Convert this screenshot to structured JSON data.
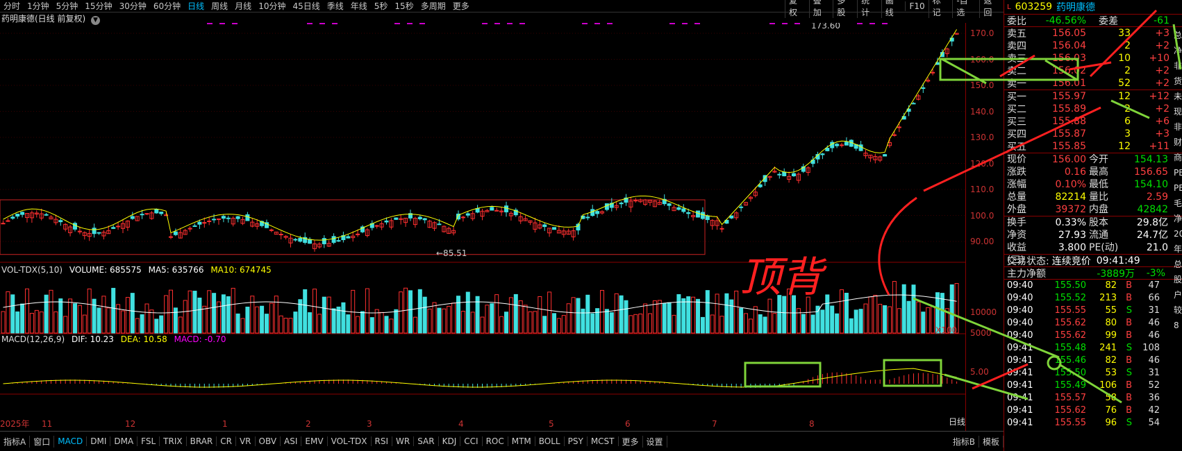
{
  "toolbar": {
    "periods": [
      "分时",
      "1分钟",
      "5分钟",
      "15分钟",
      "30分钟",
      "60分钟",
      "日线",
      "周线",
      "月线",
      "10分钟",
      "45日线",
      "季线",
      "年线",
      "5秒",
      "15秒",
      "多周期",
      "更多"
    ],
    "active_period": "日线",
    "right_buttons": [
      "复权",
      "叠加",
      "多股",
      "统计",
      "画线",
      "F10",
      "标记",
      "-自选",
      "返回"
    ]
  },
  "chart": {
    "title": "药明康德(日线 前复权)",
    "y_axis": [
      "170.0",
      "160.0",
      "150.0",
      "140.0",
      "130.0",
      "120.0",
      "110.0",
      "100.0",
      "90.00"
    ],
    "high_marker": "173.60",
    "low_marker": "85.51",
    "x_axis": [
      "2025年",
      "11",
      "12",
      "1",
      "2",
      "3",
      "4",
      "5",
      "6",
      "7",
      "8"
    ],
    "period_label": "日线",
    "vol_legend": {
      "name": "VOL-TDX(5,10)",
      "volume": "VOLUME: 685575",
      "ma5": "MA5: 635766",
      "ma10": "MA10: 674745"
    },
    "vol_axis": [
      "10000",
      "5000",
      "X100"
    ],
    "macd_legend": {
      "name": "MACD(12,26,9)",
      "dif": "DIF: 10.23",
      "dea": "DEA: 10.58",
      "macd": "MACD: -0.70"
    },
    "macd_axis": [
      "5.00"
    ],
    "annotation": "顶背"
  },
  "bottom_tabs": [
    "指标A",
    "窗口",
    "MACD",
    "DMI",
    "DMA",
    "FSL",
    "TRIX",
    "BRAR",
    "CR",
    "VR",
    "OBV",
    "ASI",
    "EMV",
    "VOL-TDX",
    "RSI",
    "WR",
    "SAR",
    "KDJ",
    "CCI",
    "ROC",
    "MTM",
    "BOLL",
    "PSY",
    "MCST",
    "更多",
    "设置"
  ],
  "bottom_right": [
    "指标B",
    "模板"
  ],
  "panel": {
    "code": "603259",
    "name": "药明康德",
    "weibi": {
      "label": "委比",
      "value": "-46.56%",
      "label2": "委差",
      "value2": "-61"
    },
    "asks": [
      {
        "label": "卖五",
        "price": "156.05",
        "vol": "33",
        "chg": "+3"
      },
      {
        "label": "卖四",
        "price": "156.04",
        "vol": "2",
        "chg": "+2"
      },
      {
        "label": "卖三",
        "price": "156.03",
        "vol": "10",
        "chg": "+10"
      },
      {
        "label": "卖二",
        "price": "156.02",
        "vol": "2",
        "chg": "+2"
      },
      {
        "label": "卖一",
        "price": "156.01",
        "vol": "52",
        "chg": "+2"
      }
    ],
    "bids": [
      {
        "label": "买一",
        "price": "155.97",
        "vol": "12",
        "chg": "+12"
      },
      {
        "label": "买二",
        "price": "155.89",
        "vol": "2",
        "chg": "+2"
      },
      {
        "label": "买三",
        "price": "155.88",
        "vol": "6",
        "chg": "+6"
      },
      {
        "label": "买四",
        "price": "155.87",
        "vol": "3",
        "chg": "+3"
      },
      {
        "label": "买五",
        "price": "155.85",
        "vol": "12",
        "chg": "+11"
      }
    ],
    "quote": [
      [
        "现价",
        "156.00",
        "今开",
        "154.13"
      ],
      [
        "涨跌",
        "0.16",
        "最高",
        "156.65"
      ],
      [
        "涨幅",
        "0.10%",
        "最低",
        "154.10"
      ],
      [
        "总量",
        "82214",
        "量比",
        "2.59"
      ],
      [
        "外盘",
        "39372",
        "内盘",
        "42842"
      ]
    ],
    "fund": [
      [
        "换手",
        "0.33%",
        "股本",
        "29.8亿"
      ],
      [
        "净资",
        "27.93",
        "流通",
        "24.7亿"
      ],
      [
        "收益(三)",
        "3.800",
        "PE(动)",
        "21.0"
      ]
    ],
    "status": {
      "label": "交易状态:",
      "value": "连续竞价",
      "time": "09:41:49"
    },
    "main_flow": {
      "label": "主力净额",
      "value": "-3889万",
      "pct": "-3%"
    },
    "ticks": [
      [
        "09:40",
        "155.50",
        "82",
        "B",
        "47"
      ],
      [
        "09:40",
        "155.52",
        "213",
        "B",
        "66"
      ],
      [
        "09:40",
        "155.55",
        "55",
        "S",
        "31"
      ],
      [
        "09:40",
        "155.62",
        "80",
        "B",
        "46"
      ],
      [
        "09:40",
        "155.62",
        "99",
        "B",
        "46"
      ],
      [
        "09:41",
        "155.48",
        "241",
        "S",
        "108"
      ],
      [
        "09:41",
        "155.46",
        "82",
        "B",
        "46"
      ],
      [
        "09:41",
        "155.50",
        "53",
        "S",
        "31"
      ],
      [
        "09:41",
        "155.49",
        "106",
        "B",
        "52"
      ],
      [
        "09:41",
        "155.57",
        "58",
        "B",
        "36"
      ],
      [
        "09:41",
        "155.62",
        "76",
        "B",
        "42"
      ],
      [
        "09:41",
        "155.55",
        "96",
        "S",
        "54"
      ]
    ],
    "side_letters": [
      "总",
      "净",
      "非",
      "货",
      "未",
      "现",
      "非",
      "财",
      "商",
      "PE",
      "PB",
      "毛",
      "净",
      "20",
      "年",
      "总",
      "股",
      "户",
      "较",
      "8"
    ]
  },
  "colors": {
    "up": "#ff3030",
    "down": "#40e0e0",
    "ma": "#ffff00",
    "annot_green": "#7fd43a",
    "annot_red": "#ff2020"
  }
}
